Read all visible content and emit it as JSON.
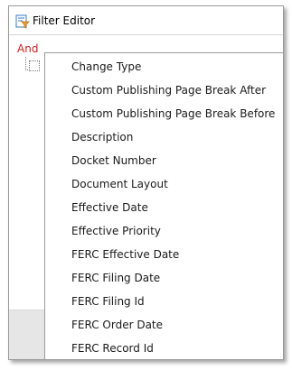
{
  "window": {
    "title": "Filter Editor"
  },
  "filter": {
    "group_operator": "And"
  },
  "dropdown": {
    "items": [
      "Change Type",
      "Custom Publishing Page Break After",
      "Custom Publishing Page Break Before",
      "Description",
      "Docket Number",
      "Document Layout",
      "Effective Date",
      "Effective Priority",
      "FERC Effective Date",
      "FERC Filing Date",
      "FERC Filing Id",
      "FERC Order Date",
      "FERC Record Id"
    ]
  },
  "colors": {
    "operator_text": "#cc2020",
    "icon_orange": "#e8a030",
    "icon_blue": "#3a78c8"
  },
  "icons": {
    "title": "filter-editor-icon"
  }
}
